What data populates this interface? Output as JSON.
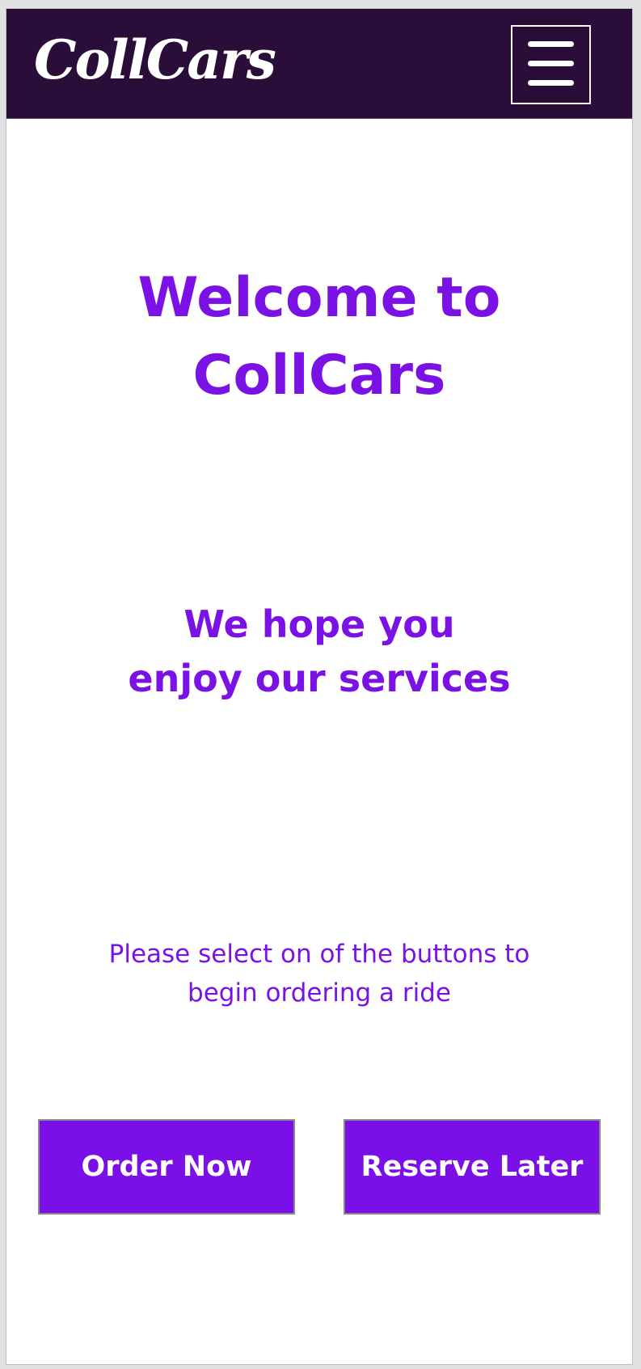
{
  "navbar": {
    "logo_text": "CollCars",
    "menu_icon": "hamburger-menu-icon",
    "background_color": "#2a0d38"
  },
  "main": {
    "welcome_line1": "Welcome to",
    "welcome_line2": "CollCars",
    "subtitle_line1": "We hope you",
    "subtitle_line2": "enjoy our services",
    "instruction_line1": "Please select on of the buttons to",
    "instruction_line2": "begin ordering a ride",
    "accent_color": "#7a12e6"
  },
  "actions": {
    "order_now_label": "Order Now",
    "reserve_later_label": "Reserve Later"
  }
}
